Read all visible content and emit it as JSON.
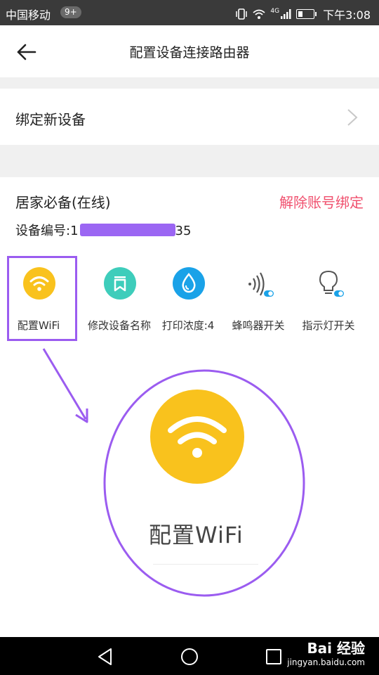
{
  "status_bar": {
    "carrier": "中国移动",
    "badge": "9+",
    "network": "4G",
    "time": "下午3:08"
  },
  "header": {
    "title": "配置设备连接路由器"
  },
  "bind_row": {
    "label": "绑定新设备"
  },
  "device": {
    "name": "居家必备(在线)",
    "unbind_label": "解除账号绑定",
    "id_prefix": "设备编号:1",
    "id_suffix": "35"
  },
  "actions": [
    {
      "label": "配置WiFi",
      "icon": "wifi-icon",
      "color": "#f9c21d"
    },
    {
      "label": "修改设备名称",
      "icon": "bookmark-icon",
      "color": "#3ecdbb"
    },
    {
      "label": "打印浓度:4",
      "icon": "water-drop-icon",
      "color": "#1aa2e8"
    },
    {
      "label": "蜂鸣器开关",
      "icon": "sound-icon",
      "color": "#1aa2e8"
    },
    {
      "label": "指示灯开关",
      "icon": "bulb-icon",
      "color": "#1aa2e8"
    }
  ],
  "zoom_callout": {
    "label": "配置WiFi"
  },
  "watermark": {
    "brand": "Bai 经验",
    "url": "jingyan.baidu.com"
  },
  "colors": {
    "accent_purple": "#9b5cf0",
    "unbind_red": "#f0506e",
    "wifi_yellow": "#f9c21d"
  }
}
